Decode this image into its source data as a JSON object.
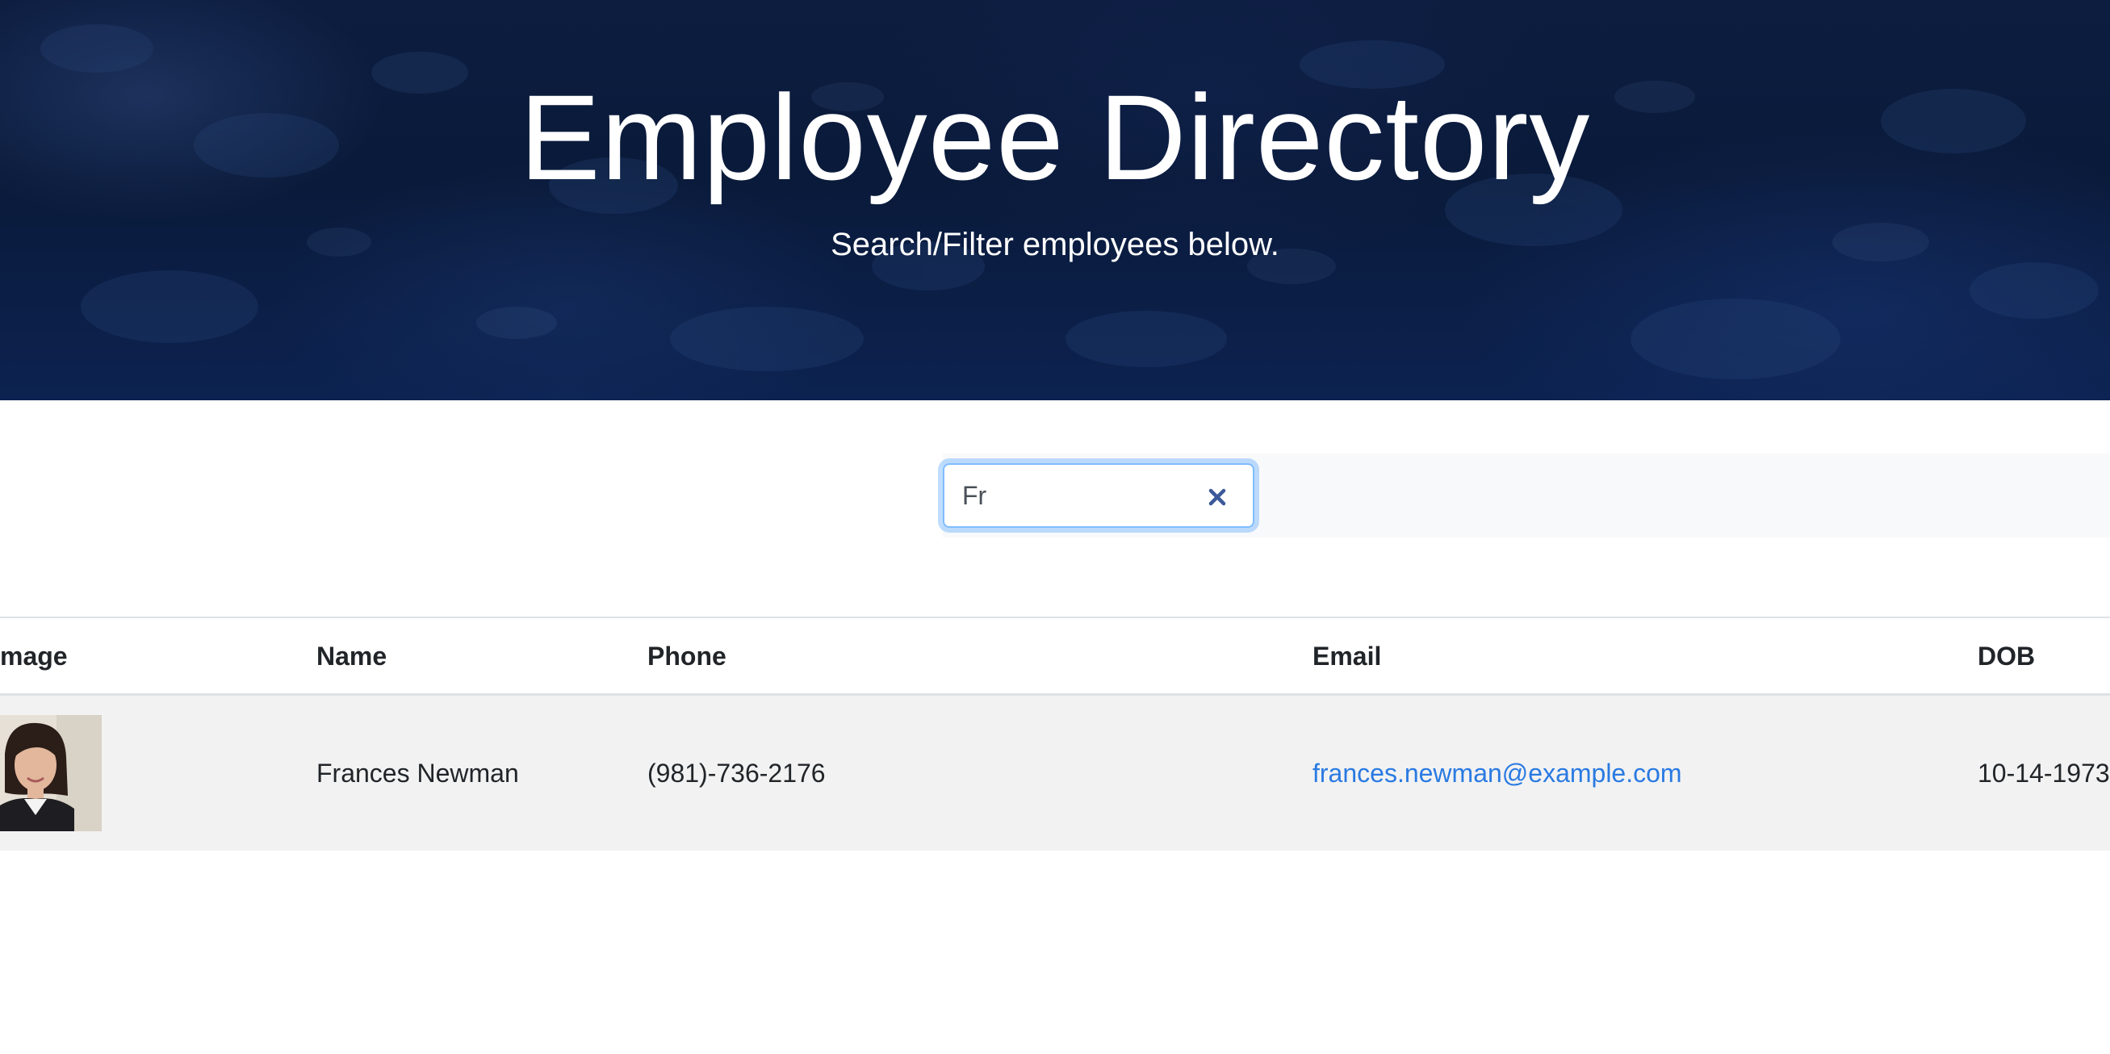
{
  "header": {
    "title": "Employee Directory",
    "subtitle": "Search/Filter employees below."
  },
  "search": {
    "value": "Fr",
    "clear_icon": "close-icon"
  },
  "table": {
    "columns": [
      "mage",
      "Name",
      "Phone",
      "Email",
      "DOB"
    ],
    "rows": [
      {
        "image": "employee-photo",
        "name": "Frances Newman",
        "phone": "(981)-736-2176",
        "email": "frances.newman@example.com",
        "dob": "10-14-1973"
      }
    ]
  },
  "colors": {
    "header_bg": "#0a1a3a",
    "link": "#2a7ae2",
    "row_stripe": "#f2f2f2",
    "focus_border": "#80bdff",
    "clear_icon": "#3b5998"
  }
}
